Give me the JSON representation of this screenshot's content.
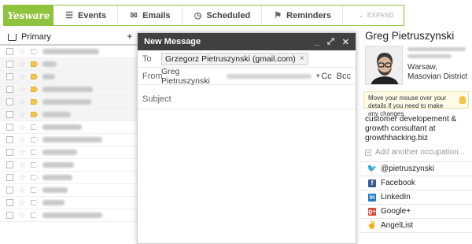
{
  "toolbar": {
    "logo": "Yesware",
    "items": [
      {
        "label": "Events",
        "icon": "list-icon"
      },
      {
        "label": "Emails",
        "icon": "envelope-icon"
      },
      {
        "label": "Scheduled",
        "icon": "clock-icon"
      },
      {
        "label": "Reminders",
        "icon": "bookmark-icon"
      }
    ],
    "expand": "EXPAND",
    "accent": "#8fc23d"
  },
  "inbox": {
    "tab": "Primary",
    "plus": "+",
    "rows": [
      {
        "read": false,
        "tag": "gray",
        "w": 72
      },
      {
        "read": true,
        "tag": "yellow",
        "w": 18
      },
      {
        "read": true,
        "tag": "yellow",
        "w": 16
      },
      {
        "read": true,
        "tag": "yellow",
        "w": 64
      },
      {
        "read": true,
        "tag": "yellow",
        "w": 62
      },
      {
        "read": true,
        "tag": "yellow",
        "w": 36
      },
      {
        "read": false,
        "tag": "gray",
        "w": 50
      },
      {
        "read": false,
        "tag": "gray",
        "w": 76
      },
      {
        "read": false,
        "tag": "gray",
        "w": 44
      },
      {
        "read": false,
        "tag": "gray",
        "w": 40
      },
      {
        "read": false,
        "tag": "gray",
        "w": 38
      },
      {
        "read": false,
        "tag": "gray",
        "w": 32
      },
      {
        "read": false,
        "tag": "gray",
        "w": 28
      },
      {
        "read": false,
        "tag": "gray",
        "w": 76
      }
    ]
  },
  "compose": {
    "title": "New Message",
    "to_label": "To",
    "recipient": "Grzegorz Pietruszynski (gmail.com)",
    "remove": "×",
    "from_label": "From",
    "from_name": "Greg Pietruszynski",
    "cc": "Cc",
    "bcc": "Bcc",
    "subject_placeholder": "Subject"
  },
  "profile": {
    "name": "Greg Pietruszynski",
    "location": "Warsaw, Masovian District",
    "tip": "Move your mouse over your details if you need to make any changes.",
    "tagline": "customer developement & growth consultant at growthhacking.biz",
    "add_occupation": "Add another occupation...",
    "social": [
      {
        "label": "@pietruszynski",
        "icon": "twitter-icon"
      },
      {
        "label": "Facebook",
        "icon": "facebook-icon"
      },
      {
        "label": "LinkedIn",
        "icon": "linkedin-icon"
      },
      {
        "label": "Google+",
        "icon": "google-plus-icon"
      },
      {
        "label": "AngelList",
        "icon": "angellist-icon"
      }
    ]
  }
}
